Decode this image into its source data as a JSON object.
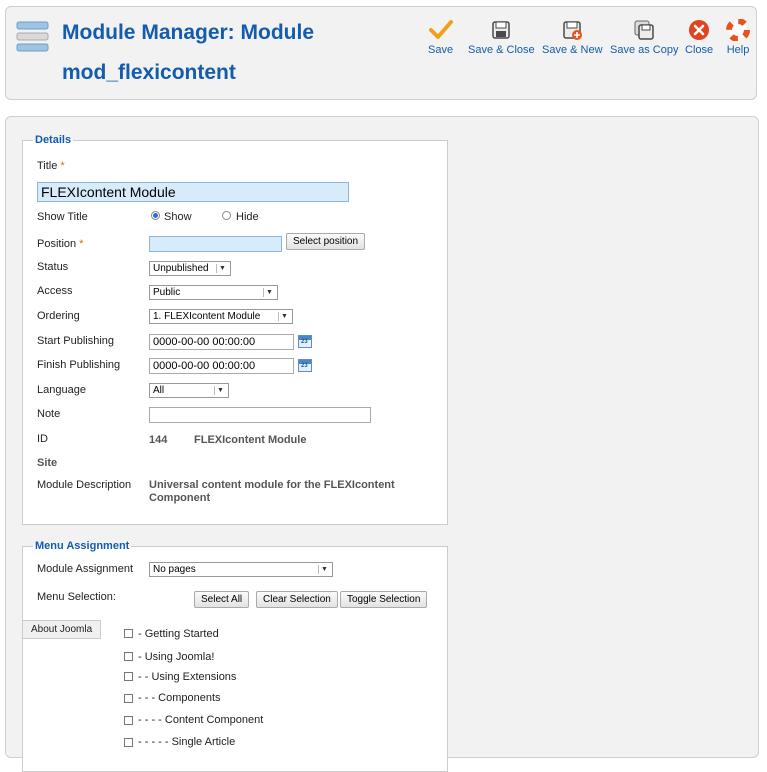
{
  "header": {
    "title_line1": "Module Manager: Module",
    "title_line2": "mod_flexicontent",
    "icon": "module-manager-icon"
  },
  "toolbar": [
    {
      "label": "Save",
      "icon": "checkmark-icon",
      "color": "#f0a01e"
    },
    {
      "label": "Save & Close",
      "icon": "save-close-icon"
    },
    {
      "label": "Save & New",
      "icon": "save-new-icon"
    },
    {
      "label": "Save as Copy",
      "icon": "save-copy-icon"
    },
    {
      "label": "Close",
      "icon": "close-icon",
      "color": "#e2421f"
    },
    {
      "label": "Help",
      "icon": "help-lifebuoy-icon",
      "color": "#e8531d"
    }
  ],
  "details": {
    "legend": "Details",
    "title_label": "Title",
    "required_mark": "*",
    "title_value": "FLEXIcontent Module",
    "show_title_label": "Show Title",
    "show_option": "Show",
    "hide_option": "Hide",
    "show_title_selected": "Show",
    "position_label": "Position",
    "position_value": "",
    "select_position_button": "Select position",
    "status_label": "Status",
    "status_value": "Unpublished",
    "access_label": "Access",
    "access_value": "Public",
    "ordering_label": "Ordering",
    "ordering_value": "1. FLEXIcontent Module",
    "start_publishing_label": "Start Publishing",
    "start_publishing_value": "0000-00-00 00:00:00",
    "finish_publishing_label": "Finish Publishing",
    "finish_publishing_value": "0000-00-00 00:00:00",
    "calendar_day": "23",
    "language_label": "Language",
    "language_value": "All",
    "note_label": "Note",
    "note_value": "",
    "id_label": "ID",
    "id_value": "144",
    "id_name": "FLEXIcontent Module",
    "site_label": "Site",
    "description_label": "Module Description",
    "description_line1": "Universal content module for the FLEXIcontent",
    "description_line2": "Component"
  },
  "menu_assignment": {
    "legend": "Menu Assignment",
    "assignment_label": "Module Assignment",
    "assignment_value": "No pages",
    "selection_label": "Menu Selection:",
    "select_all_button": "Select All",
    "clear_selection_button": "Clear Selection",
    "toggle_selection_button": "Toggle Selection",
    "tab_label": "About Joomla",
    "items": [
      {
        "label": "- Getting Started",
        "checked": false
      },
      {
        "label": "- Using Joomla!",
        "checked": false
      },
      {
        "label": "- - Using Extensions",
        "checked": false
      },
      {
        "label": "- - - Components",
        "checked": false
      },
      {
        "label": "- - - - Content Component",
        "checked": false
      },
      {
        "label": "- - - - - Single Article",
        "checked": false
      }
    ]
  }
}
